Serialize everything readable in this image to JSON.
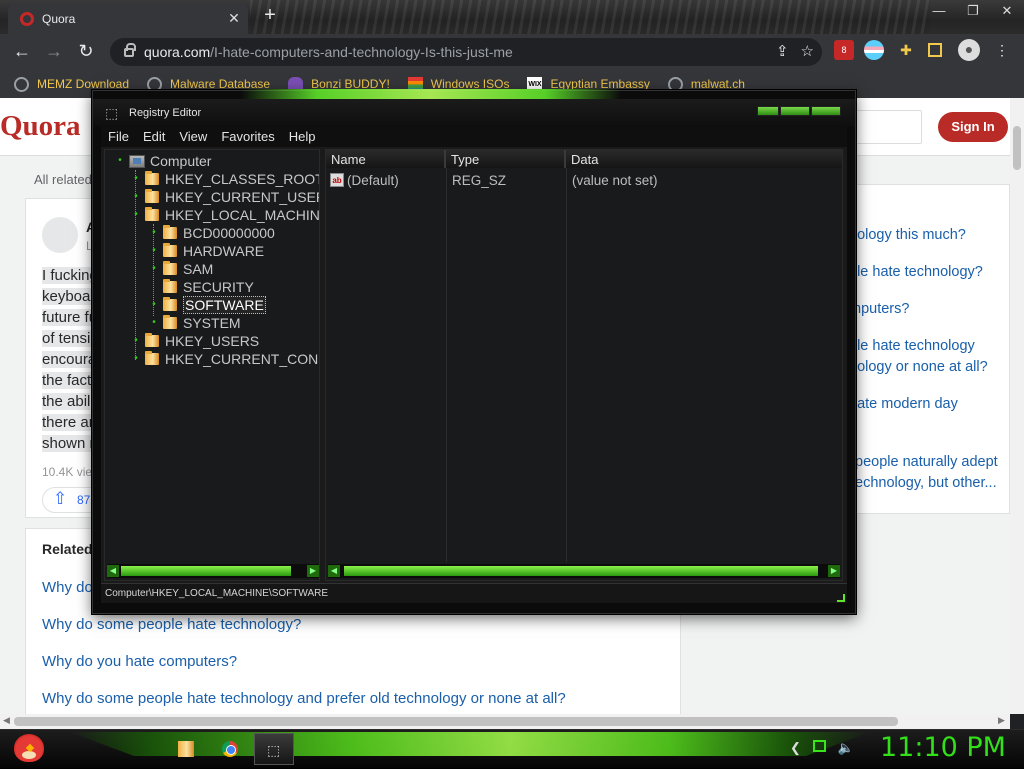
{
  "browser": {
    "tab_title": "Quora",
    "tab_close": "✕",
    "new_tab": "+",
    "window_controls": [
      "—",
      "❐",
      "✕"
    ],
    "nav": {
      "back": "←",
      "forward": "→",
      "reload": "↻"
    },
    "url_host": "quora.com",
    "url_path": "/I-hate-computers-and-technology-Is-this-just-me",
    "extension_badge": "8",
    "bookmarks": [
      {
        "label": "MEMZ Download",
        "icon": "globe-icon"
      },
      {
        "label": "Malware Database",
        "icon": "globe-icon"
      },
      {
        "label": "Bonzi BUDDY!",
        "icon": "bonzi-icon"
      },
      {
        "label": "Windows ISOs",
        "icon": "windows-icon"
      },
      {
        "label": "Egyptian Embassy",
        "icon": "wix-icon"
      },
      {
        "label": "malwat.ch",
        "icon": "globe-icon"
      }
    ]
  },
  "quora": {
    "logo": "Quora",
    "sign_in": "Sign In",
    "all_related": "All related",
    "answer_initial": "A",
    "answer_sub": "L",
    "answer_lines": [
      "I fucking",
      "keyboar",
      "future fu",
      "of tensic",
      "encoura",
      "the fact",
      "the abil",
      "there ar",
      "shown r"
    ],
    "views": "10.4K vie",
    "upvotes": "87",
    "related_title": "Related",
    "related_questions": [
      "Why do",
      "Why do some people hate technology?",
      "Why do you hate computers?",
      "Why do some people hate technology and prefer old technology or none at all?"
    ],
    "side_questions": [
      "nology this much?",
      "ple hate technology?",
      "mputers?",
      "ple hate technology",
      "nology or none at all?",
      "hate modern day",
      "people naturally adept",
      "echnology, but other..."
    ]
  },
  "regedit": {
    "title": "Registry Editor",
    "menu": [
      "File",
      "Edit",
      "View",
      "Favorites",
      "Help"
    ],
    "tree": {
      "root": "Computer",
      "hives": [
        "HKEY_CLASSES_ROOT",
        "HKEY_CURRENT_USER",
        "HKEY_LOCAL_MACHINE"
      ],
      "hklm_children": [
        "BCD00000000",
        "HARDWARE",
        "SAM",
        "SECURITY",
        "SOFTWARE",
        "SYSTEM"
      ],
      "more_hives": [
        "HKEY_USERS",
        "HKEY_CURRENT_CONFI"
      ]
    },
    "columns": [
      "Name",
      "Type",
      "Data"
    ],
    "rows": [
      {
        "name": "(Default)",
        "type": "REG_SZ",
        "data": "(value not set)"
      }
    ],
    "status_path": "Computer\\HKEY_LOCAL_MACHINE\\SOFTWARE"
  },
  "taskbar": {
    "clock": "11:10 PM"
  }
}
